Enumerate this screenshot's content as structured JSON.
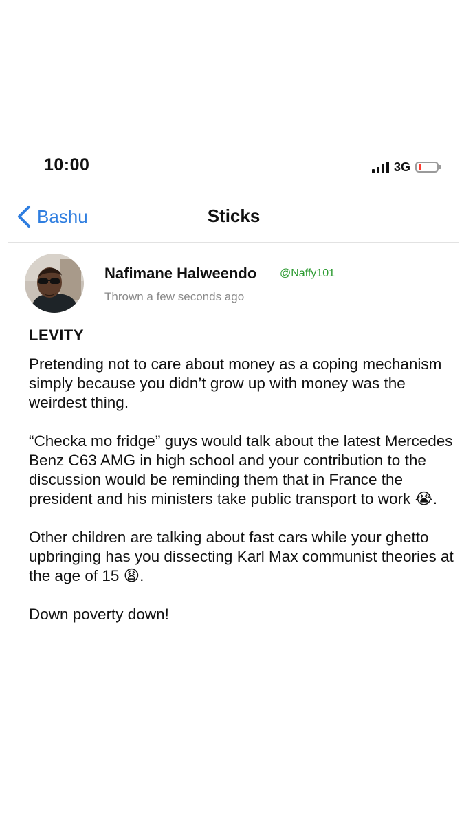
{
  "status_bar": {
    "time": "10:00",
    "network": "3G",
    "battery_color": "#ff3b30",
    "icons": [
      "signal-icon",
      "battery-icon"
    ]
  },
  "nav": {
    "back_label": "Bashu",
    "title": "Sticks",
    "accent_color": "#2f7ee0"
  },
  "post": {
    "author_name": "Nafimane Halweendo",
    "author_handle": "@Naffy101",
    "time": "Thrown a few seconds ago",
    "title": "LEVITY",
    "paragraphs": [
      "Pretending not to care about money as a coping mechanism simply because you didn’t grow up with money was the weirdest thing.",
      "“Checka mo fridge” guys would talk about the latest Mercedes Benz C63 AMG in high school and your contribution to the discussion would be  reminding them that in France the president and his ministers take public transport to work 😭.",
      "Other children are talking about fast cars while your ghetto upbringing has you dissecting Karl Max communist theories at the age of 15 😩.",
      "Down poverty down!"
    ],
    "handle_color": "#2a9a2f"
  }
}
